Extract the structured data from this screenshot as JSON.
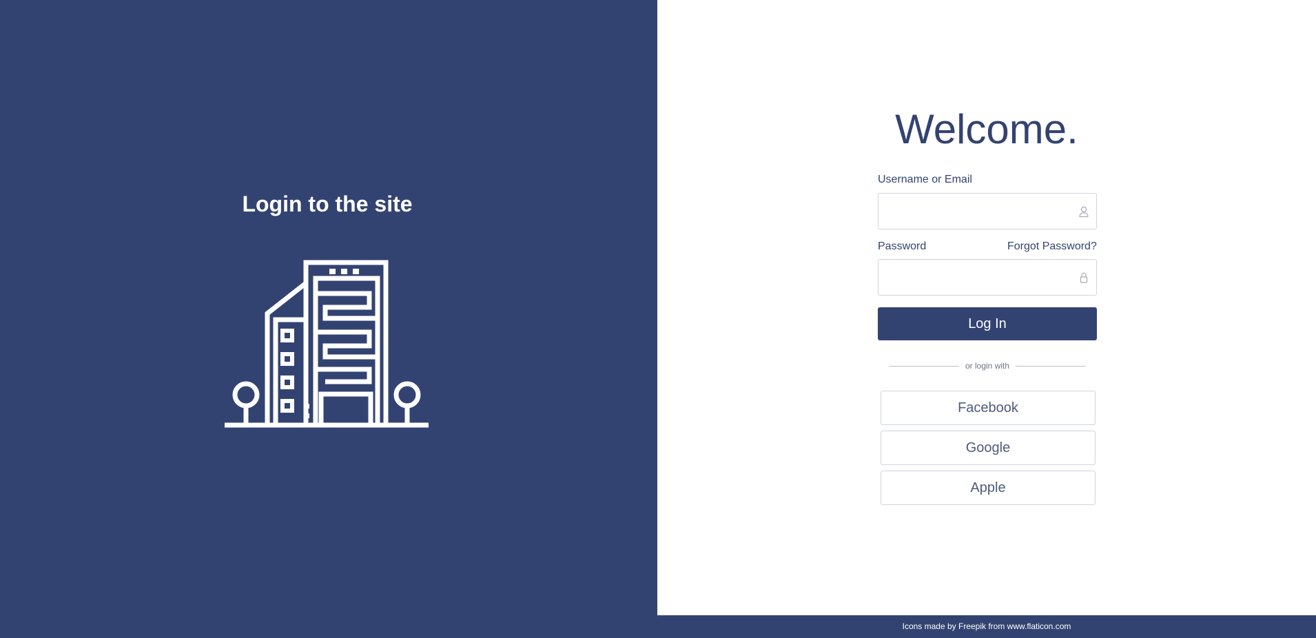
{
  "left": {
    "title": "Login to the site",
    "illustration_icon": "office-building-icon"
  },
  "right": {
    "welcome": "Welcome.",
    "username": {
      "label": "Username or Email",
      "value": "",
      "placeholder": "",
      "icon": "user-icon"
    },
    "password": {
      "label": "Password",
      "value": "",
      "placeholder": "",
      "icon": "lock-icon"
    },
    "forgot_password": "Forgot Password?",
    "login_button": "Log In",
    "divider_text": "or login with",
    "social": {
      "facebook": "Facebook",
      "google": "Google",
      "apple": "Apple"
    }
  },
  "footer": {
    "credit": "Icons made by Freepik from www.flaticon.com"
  },
  "colors": {
    "primary": "#334371",
    "background": "#ffffff",
    "border": "#cfd3da"
  }
}
